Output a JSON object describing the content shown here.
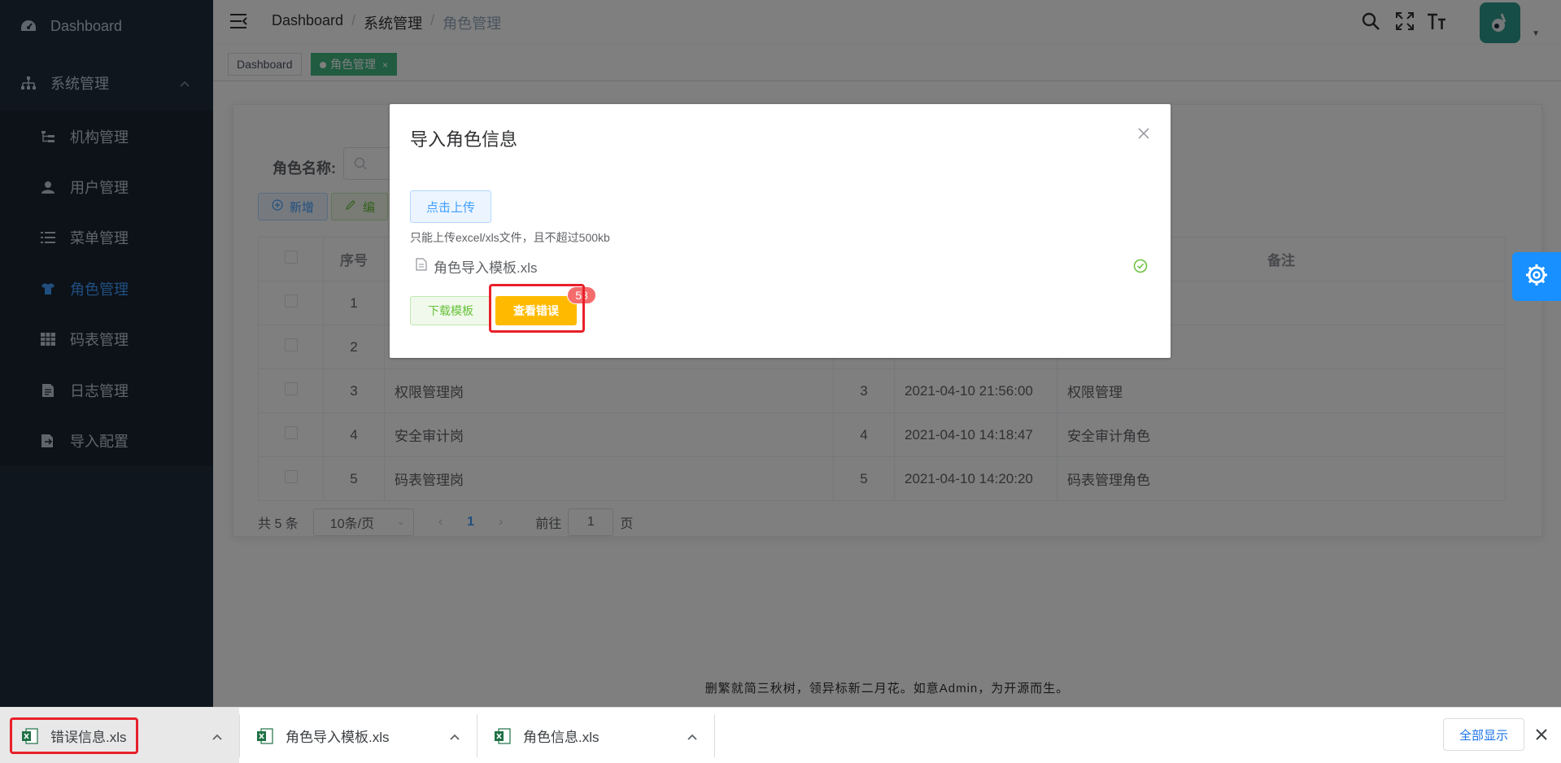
{
  "sidebar": {
    "dashboard": "Dashboard",
    "system": "系统管理",
    "items": [
      {
        "label": "机构管理",
        "icon": "tree-icon"
      },
      {
        "label": "用户管理",
        "icon": "user-icon"
      },
      {
        "label": "菜单管理",
        "icon": "list-icon"
      },
      {
        "label": "角色管理",
        "icon": "shirt-icon"
      },
      {
        "label": "码表管理",
        "icon": "table-icon"
      },
      {
        "label": "日志管理",
        "icon": "document-icon"
      },
      {
        "label": "导入配置",
        "icon": "import-icon"
      }
    ]
  },
  "header": {
    "breadcrumb": [
      "Dashboard",
      "系统管理",
      "角色管理"
    ],
    "separator": "/"
  },
  "tags": {
    "dashboard": "Dashboard",
    "active": "角色管理",
    "close": "×"
  },
  "search": {
    "label": "角色名称:"
  },
  "toolbar": {
    "add": "新增",
    "edit": "编"
  },
  "table": {
    "headers": {
      "index": "序号",
      "remark": "备注"
    },
    "rows": [
      {
        "index": "1",
        "name": "",
        "sort": "",
        "time": "",
        "remark": ""
      },
      {
        "index": "2",
        "name": "",
        "sort": "",
        "time": "",
        "remark": ""
      },
      {
        "index": "3",
        "name": "权限管理岗",
        "sort": "3",
        "time": "2021-04-10 21:56:00",
        "remark": "权限管理"
      },
      {
        "index": "4",
        "name": "安全审计岗",
        "sort": "4",
        "time": "2021-04-10 14:18:47",
        "remark": "安全审计角色"
      },
      {
        "index": "5",
        "name": "码表管理岗",
        "sort": "5",
        "time": "2021-04-10 14:20:20",
        "remark": "码表管理角色"
      }
    ]
  },
  "pager": {
    "total": "共 5 条",
    "size": "10条/页",
    "current": "1",
    "goto_label": "前往",
    "goto_value": "1",
    "page_unit": "页"
  },
  "footer": "删繁就简三秋树，领异标新二月花。如意Admin，为开源而生。",
  "dialog": {
    "title": "导入角色信息",
    "upload": "点击上传",
    "tip": "只能上传excel/xls文件，且不超过500kb",
    "file": "角色导入模板.xls",
    "download_template": "下载模板",
    "view_errors": "查看错误",
    "error_count": "58"
  },
  "downloads": {
    "items": [
      "错误信息.xls",
      "角色导入模板.xls",
      "角色信息.xls"
    ],
    "show_all": "全部显示"
  },
  "colors": {
    "sidebar_bg": "#1f2d3d",
    "active_menu": "#409eff",
    "tag_active": "#42b983",
    "warning": "#ffba00",
    "danger": "#f56c6c",
    "highlight": "#e8202a"
  }
}
